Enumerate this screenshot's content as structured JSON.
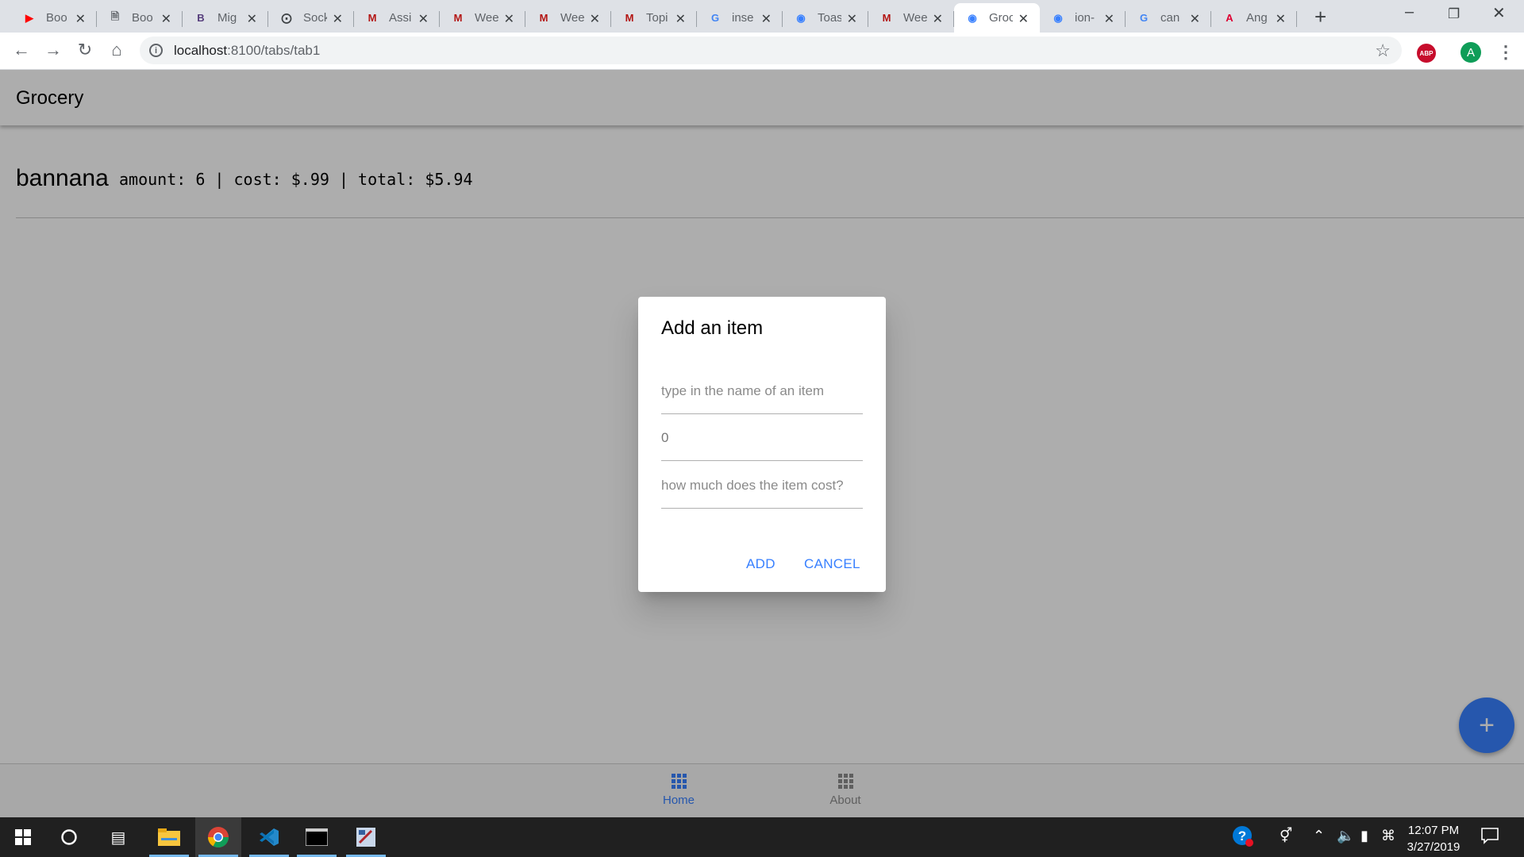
{
  "browser": {
    "tabs": [
      {
        "title": "Boo",
        "favicon": "youtube-icon",
        "color": "#ff0000"
      },
      {
        "title": "Boo",
        "favicon": "document-icon",
        "color": "#5f6368"
      },
      {
        "title": "Mig",
        "favicon": "bootstrap-icon",
        "color": "#563d7c"
      },
      {
        "title": "Sock",
        "favicon": "compass-icon",
        "color": "#3c4043"
      },
      {
        "title": "Assi",
        "favicon": "gmail-icon",
        "color": "#b31412"
      },
      {
        "title": "Wee",
        "favicon": "gmail-icon",
        "color": "#b31412"
      },
      {
        "title": "Wee",
        "favicon": "gmail-icon",
        "color": "#b31412"
      },
      {
        "title": "Topi",
        "favicon": "gmail-icon",
        "color": "#b31412"
      },
      {
        "title": "inse",
        "favicon": "google-icon",
        "color": "#4285f4"
      },
      {
        "title": "Toas",
        "favicon": "ionic-icon",
        "color": "#3880ff"
      },
      {
        "title": "Wee",
        "favicon": "gmail-icon",
        "color": "#b31412"
      },
      {
        "title": "Groc",
        "favicon": "ionic-icon",
        "color": "#3880ff",
        "active": true
      },
      {
        "title": "ion-",
        "favicon": "ionic-icon",
        "color": "#3880ff"
      },
      {
        "title": "can",
        "favicon": "google-icon",
        "color": "#4285f4"
      },
      {
        "title": "Ang",
        "favicon": "angular-icon",
        "color": "#dd0031"
      }
    ],
    "url_host": "localhost",
    "url_path": ":8100/tabs/tab1",
    "avatar_letter": "A",
    "abp_label": "ABP"
  },
  "app": {
    "title": "Grocery",
    "items": [
      {
        "name": "bannana",
        "detail": "amount: 6 | cost: $.99 | total: $5.94"
      }
    ],
    "tabs": [
      {
        "label": "Home",
        "selected": true
      },
      {
        "label": "About",
        "selected": false
      }
    ],
    "fab_icon": "add-icon"
  },
  "dialog": {
    "title": "Add an item",
    "name_placeholder": "type in the name of an item",
    "amount_value": "0",
    "cost_placeholder": "how much does the item cost?",
    "add_label": "ADD",
    "cancel_label": "CANCEL",
    "accent": "#3880ff"
  },
  "taskbar": {
    "time": "12:07 PM",
    "date": "3/27/2019"
  }
}
